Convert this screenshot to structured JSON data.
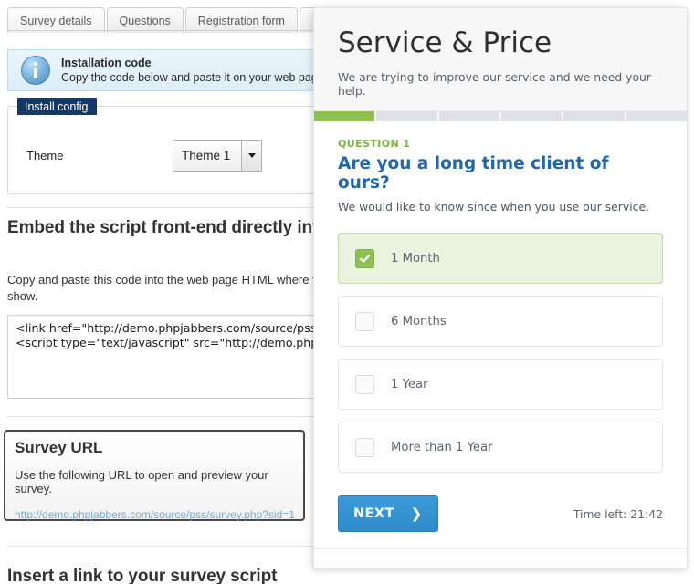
{
  "admin": {
    "tabs": [
      {
        "label": "Survey details"
      },
      {
        "label": "Questions"
      },
      {
        "label": "Registration form"
      },
      {
        "label": ""
      }
    ],
    "info": {
      "icon": "info-circle-icon",
      "title": "Installation code",
      "subtitle": "Copy the code below and paste it on your web page"
    },
    "fieldset": {
      "legend": "Install config",
      "theme_label": "Theme",
      "theme_value": "Theme 1"
    },
    "embed": {
      "heading": "Embed the script front-end directly into your website",
      "paragraph": "Copy and paste this code into the web page HTML where you want the script to show.",
      "code": "<link href=\"http://demo.phpjabbers.com/source/pss/index.php?controller=pjFront&action=pjActionLoadCss&sid=1\" type=\"text/css\" rel=\"stylesheet\" />\n<script type=\"text/javascript\" src=\"http://demo.phpjabbers.com/source/pss/index.php?controller=pjFront&action=pjActionLoadJs&sid=1\"></script>"
    },
    "survey_url": {
      "title": "Survey URL",
      "description": "Use the following URL to open and preview your survey.",
      "link": "http://demo.phpjabbers.com/source/pss/survey.php?sid=1"
    },
    "insert_link_heading": "Insert a link to your survey script"
  },
  "survey": {
    "title": "Service & Price",
    "subtitle": "We are trying to improve our service and we need your help.",
    "progress": {
      "segments": 6,
      "completed": 1,
      "done_color": "#8cc152",
      "todo_color": "#dde1e6"
    },
    "question": {
      "number_label": "QUESTION 1",
      "text": "Are you a long time client of ours?",
      "description": "We would like to know since when you use our service.",
      "options": [
        {
          "label": "1 Month",
          "selected": true
        },
        {
          "label": "6 Months",
          "selected": false
        },
        {
          "label": "1 Year",
          "selected": false
        },
        {
          "label": "More than 1 Year",
          "selected": false
        }
      ]
    },
    "footer": {
      "next_label": "NEXT",
      "next_chevron": "❯",
      "time_left": "Time left: 21:42"
    },
    "accent_blue": "#2167ae",
    "accent_green": "#79b341",
    "button_blue": "#3498db"
  }
}
